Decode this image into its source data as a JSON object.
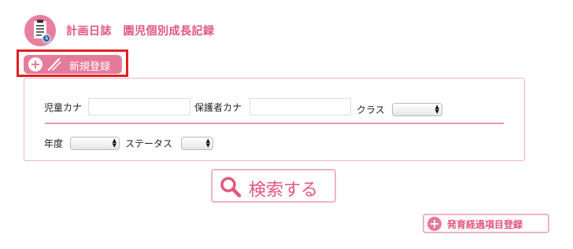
{
  "header": {
    "title": "計画日誌　園児個別成長記録",
    "icon": "clipboard-icon"
  },
  "toolbar": {
    "new_label": "新規登録",
    "new_icons": [
      "plus-circle-icon",
      "pencil-icon"
    ]
  },
  "search_form": {
    "child_kana_label": "児童カナ",
    "child_kana_value": "",
    "guardian_kana_label": "保護者カナ",
    "guardian_kana_value": "",
    "class_label": "クラス",
    "class_selected": "",
    "year_label": "年度",
    "year_selected": "",
    "status_label": "ステータス",
    "status_selected": ""
  },
  "actions": {
    "search_label": "検索する",
    "search_icon": "magnifier-icon",
    "growth_register_label": "発育経過項目登録",
    "growth_register_icon": "plus-circle-icon"
  },
  "colors": {
    "accent": "#e57b9a",
    "accent_text": "#e2577d",
    "border_pink": "#efb7c8",
    "highlight_red": "#e0201f"
  }
}
